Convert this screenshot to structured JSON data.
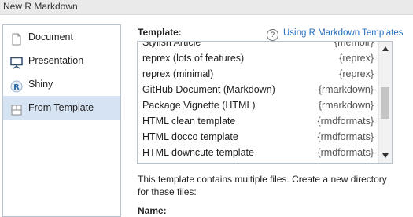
{
  "window": {
    "title": "New R Markdown"
  },
  "sidebar": {
    "items": [
      {
        "label": "Document",
        "icon": "document-icon",
        "selected": false
      },
      {
        "label": "Presentation",
        "icon": "presentation-icon",
        "selected": false
      },
      {
        "label": "Shiny",
        "icon": "shiny-icon",
        "selected": false
      },
      {
        "label": "From Template",
        "icon": "template-icon",
        "selected": true
      }
    ]
  },
  "template_panel": {
    "label": "Template:",
    "help_link": "Using R Markdown Templates",
    "templates": [
      {
        "name": "Stylish Article",
        "package": "{memoir}"
      },
      {
        "name": "reprex (lots of features)",
        "package": "{reprex}"
      },
      {
        "name": "reprex (minimal)",
        "package": "{reprex}"
      },
      {
        "name": "GitHub Document (Markdown)",
        "package": "{rmarkdown}"
      },
      {
        "name": "Package Vignette (HTML)",
        "package": "{rmarkdown}"
      },
      {
        "name": "HTML clean template",
        "package": "{rmdformats}"
      },
      {
        "name": "HTML docco template",
        "package": "{rmdformats}"
      },
      {
        "name": "HTML downcute template",
        "package": "{rmdformats}"
      }
    ],
    "info_text": "This template contains multiple files. Create a new directory for these files:",
    "name_label": "Name:"
  },
  "colors": {
    "selected_bg": "#d6e3f2",
    "link": "#2a6ebb",
    "border": "#b9c2cc"
  }
}
